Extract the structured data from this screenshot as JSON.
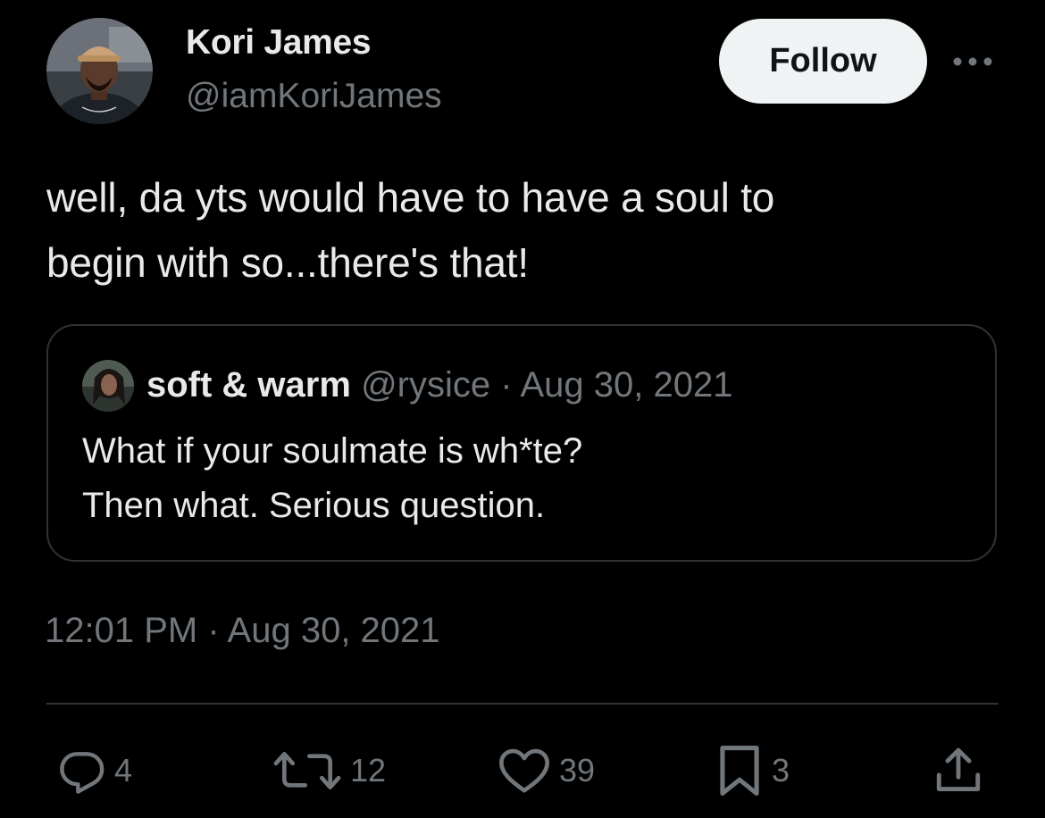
{
  "author": {
    "display_name": "Kori James",
    "handle": "@iamKoriJames",
    "avatar_icon": "profile-photo"
  },
  "follow_label": "Follow",
  "more_icon": "more-horizontal-icon",
  "tweet": {
    "text_lines": [
      "well, da yts would have to have a soul to",
      "begin with so...there's that!"
    ],
    "timestamp": "12:01 PM · Aug 30, 2021"
  },
  "quoted_tweet": {
    "display_name": "soft & warm",
    "handle": "@rysice",
    "separator": "·",
    "date": "Aug 30, 2021",
    "text_lines": [
      "What if your soulmate is wh*te?",
      "Then what. Serious question."
    ]
  },
  "actions": {
    "replies": {
      "icon": "reply-icon",
      "count": "4"
    },
    "reposts": {
      "icon": "repost-icon",
      "count": "12"
    },
    "likes": {
      "icon": "heart-icon",
      "count": "39"
    },
    "bookmarks": {
      "icon": "bookmark-icon",
      "count": "3"
    },
    "share": {
      "icon": "share-icon"
    }
  },
  "colors": {
    "background": "#000000",
    "primary_text": "#e7e9ea",
    "secondary_text": "#71767b",
    "border": "#2f3336",
    "follow_button_bg": "#eff3f4",
    "follow_button_text": "#0f1419"
  }
}
